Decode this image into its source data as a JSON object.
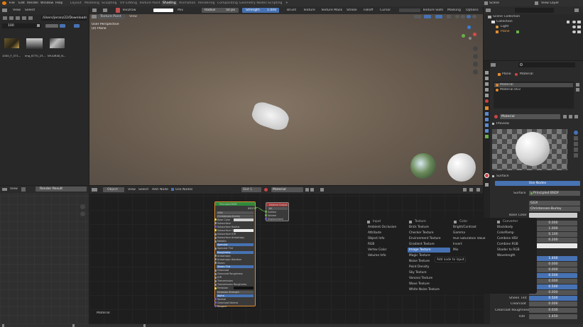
{
  "topbar": {
    "menus": [
      "File",
      "Edit",
      "Render",
      "Window",
      "Help"
    ],
    "workspaces": [
      "Layout",
      "Modeling",
      "Sculpting",
      "UV Editing",
      "Texture Paint",
      "Shading",
      "Animation",
      "Rendering",
      "Compositing",
      "Geometry Nodes",
      "Scripting"
    ],
    "active_workspace": "Shading",
    "add_tab": "+",
    "scene": "Scene",
    "view_layer": "View Layer"
  },
  "tool_header": {
    "mode": "TexDraw",
    "blend": "Mix",
    "radius_label": "Radius",
    "radius_value": "50 px",
    "strength_label": "Strength",
    "strength_value": "1.000",
    "menus": [
      "Brush",
      "Texture",
      "Texture Mask",
      "Stroke",
      "Falloff",
      "Cursor"
    ],
    "texture_slots": "Texture Slots",
    "masking": "Masking",
    "options": "Options"
  },
  "filebrowser": {
    "menus": [
      "View",
      "Select"
    ],
    "path": "/Users/jeranz22/Downloads/",
    "search": "100",
    "thumbnails": [
      "1000_F_571...",
      "img_6770_23...",
      "NY-AIR48_N..."
    ]
  },
  "viewport": {
    "mode": "Texture Paint",
    "view_menu": "View",
    "overlay_title": "User Perspective",
    "overlay_object": "(0) Plane"
  },
  "outliner": {
    "search": "",
    "items": [
      "Scene Collection",
      "Collection",
      "Light",
      "Plane"
    ]
  },
  "image_editor": {
    "view_menu": "View",
    "image": "Render Result"
  },
  "node_editor": {
    "object_mode": "Object",
    "menus": [
      "View",
      "Select",
      "Add",
      "Node"
    ],
    "use_nodes": "Use Nodes",
    "slot": "Slot 1",
    "material": "Material",
    "label": "Material"
  },
  "bsdf_node": {
    "title": "Principled BSDF",
    "bsdf_out": "BSDF",
    "rows": [
      "GGX",
      "Christensen-Burley",
      "Base Color",
      "Subsurface",
      "Subsurface Radius",
      "Subsurface Color",
      "Subsurface IOR",
      "Subsurface Anisotropy",
      "Metallic",
      "Specular",
      "Specular Tint",
      "Roughness",
      "Anisotropic",
      "Anisotropic Rotation",
      "Sheen",
      "Sheen Tint",
      "Clearcoat",
      "Clearcoat Roughness",
      "IOR",
      "Transmission",
      "Transmission Roughness",
      "Emission",
      "Emission Strength",
      "Alpha",
      "Normal",
      "Clearcoat Normal",
      "Tangent"
    ]
  },
  "output_node": {
    "title": "Material Output",
    "target": "All",
    "rows": [
      "Surface",
      "Volume",
      "Displacement"
    ]
  },
  "add_menu": {
    "input_title": "Input",
    "input_items": [
      "Ambient Occlusion",
      "Attribute",
      "Object Info",
      "RGB",
      "Vertex Color",
      "Volume Info"
    ],
    "texture_title": "Texture",
    "texture_items": [
      "Brick Texture",
      "Checker Texture",
      "Environment Texture",
      "Gradient Texture",
      "Image Texture",
      "Magic Texture",
      "Noise Texture",
      "Point Density",
      "Sky Texture",
      "Voronoi Texture",
      "Wave Texture",
      "White Noise Texture"
    ],
    "texture_selected": "Image Texture",
    "color_title": "Color",
    "color_items": [
      "Bright/Contrast",
      "Gamma",
      "Hue Saturation Value",
      "Invert",
      "Mix"
    ],
    "converter_title": "Converter",
    "converter_items": [
      "Blackbody",
      "ColorRamp",
      "Combine HSV",
      "Combine RGB",
      "Shader to RGB",
      "Wavelength"
    ],
    "tooltip": "Add node to input."
  },
  "properties": {
    "breadcrumb_object": "Plane",
    "breadcrumb_material": "Material",
    "slots": [
      "Material",
      "Material.003"
    ],
    "material_name": "Material",
    "preview_label": "Preview",
    "surface_label": "Surface",
    "use_nodes_button": "Use Nodes",
    "surface_field_label": "Surface",
    "surface_value": "Principled BSDF",
    "distribution": "GGX",
    "subsurface_method": "Christensen-Burley",
    "base_color_label": "Base Color",
    "values": [
      "0.000",
      "1.000",
      "0.100",
      "0.200",
      "",
      "1.400",
      "0.000",
      "0.000",
      "0.500",
      "0.000",
      "0.500",
      "0.000",
      "0.000",
      "0.000"
    ],
    "bottom_rows": [
      {
        "label": "Sheen Tint",
        "value": "0.500"
      },
      {
        "label": "Clearcoat",
        "value": "0.000"
      },
      {
        "label": "Clearcoat Roughness",
        "value": "0.030"
      },
      {
        "label": "IOR",
        "value": "1.450"
      }
    ]
  },
  "colors": {
    "accent": "#4772b3",
    "header": "#303030",
    "panel": "#2b2b2b",
    "node_green": "#2f8a3c",
    "node_red": "#a43c3c",
    "selected": "#e28b2b"
  }
}
